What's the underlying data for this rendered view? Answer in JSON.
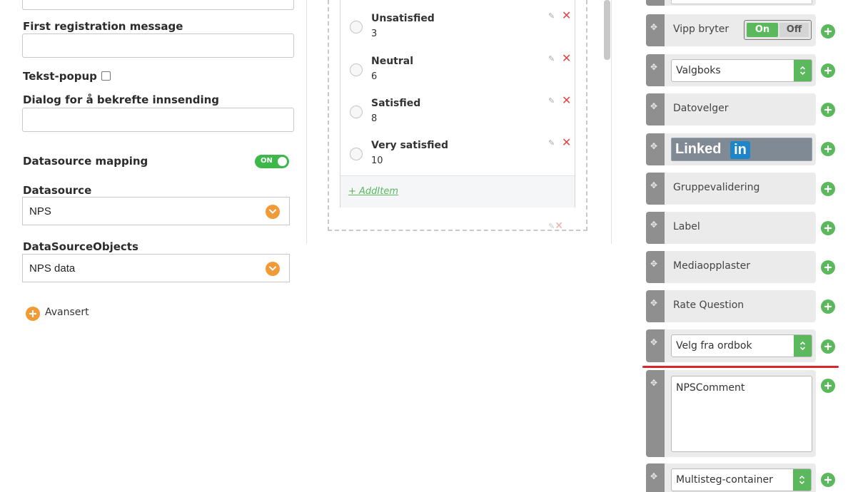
{
  "form": {
    "first_registration_label": "First registration message",
    "first_registration_value": "",
    "text_popup_label": "Tekst-popup",
    "confirm_dialog_label": "Dialog for å bekrefte innsending",
    "confirm_dialog_value": "",
    "datasource_mapping_label": "Datasource mapping",
    "datasource_mapping_toggle": "ON",
    "datasource_label": "Datasource",
    "datasource_value": "NPS",
    "datasource_objects_label": "DataSourceObjects",
    "datasource_objects_value": "NPS data",
    "advanced_label": "Avansert"
  },
  "options": {
    "items": [
      {
        "name": "Unsatisfied",
        "value": "3"
      },
      {
        "name": "Neutral",
        "value": "6"
      },
      {
        "name": "Satisfied",
        "value": "8"
      },
      {
        "name": "Very satisfied",
        "value": "10"
      }
    ],
    "add_item_label": "+ AddItem"
  },
  "toolbox": {
    "toggle": {
      "label": "Vipp bryter",
      "on": "On",
      "off": "Off"
    },
    "select": {
      "value": "Valgboks"
    },
    "date_picker": {
      "label": "Datovelger"
    },
    "linkedin": {
      "text": "Linked",
      "box": "in"
    },
    "group_validation": {
      "label": "Gruppevalidering"
    },
    "label": {
      "label": "Label"
    },
    "media_upload": {
      "label": "Mediaopplaster"
    },
    "rate_question": {
      "label": "Rate Question"
    },
    "dictionary": {
      "value": "Velg fra ordbok"
    },
    "nps_comment": {
      "value": "NPSComment"
    },
    "multistep": {
      "value": "Multisteg-container"
    }
  },
  "colors": {
    "orange_accent": "#f29a35",
    "green_accent": "#5cb85c",
    "toggle_green": "#3fb84a",
    "delete_red": "#e04545",
    "separator_red": "#d9262c",
    "handle_grey": "#8f8f8f"
  }
}
